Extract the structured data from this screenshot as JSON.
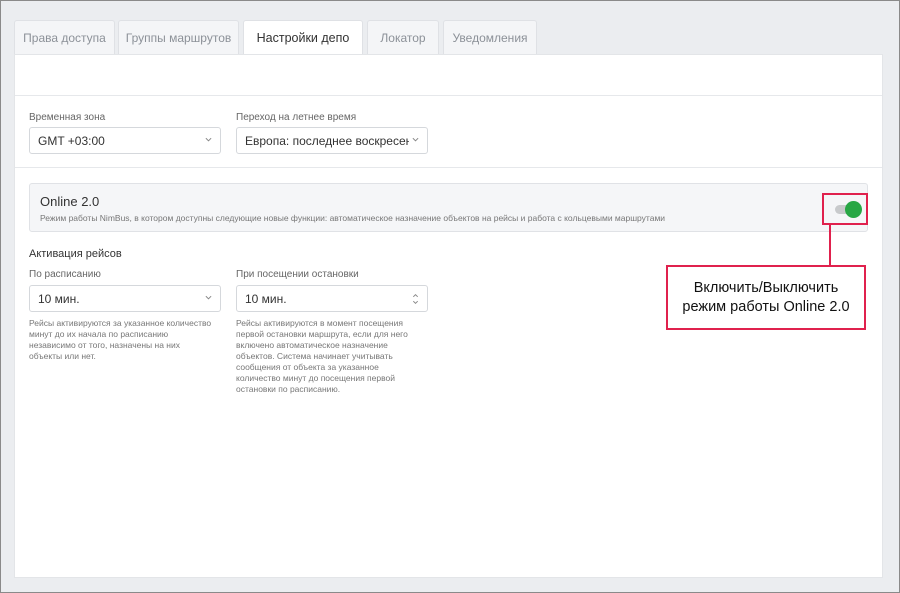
{
  "tabs": [
    {
      "label": "Права доступа",
      "active": false
    },
    {
      "label": "Группы маршрутов",
      "active": false
    },
    {
      "label": "Настройки депо",
      "active": true
    },
    {
      "label": "Локатор",
      "active": false
    },
    {
      "label": "Уведомления",
      "active": false
    }
  ],
  "timezone": {
    "label": "Временная зона",
    "value": "GMT +03:00"
  },
  "dst": {
    "label": "Переход на летнее время",
    "value": "Европа: последнее воскресенье..."
  },
  "online": {
    "title": "Online 2.0",
    "description": "Режим работы NimBus, в котором доступны следующие новые функции: автоматическое назначение объектов на рейсы и работа с кольцевыми маршрутами",
    "enabled": true
  },
  "activation": {
    "title": "Активация рейсов",
    "schedule": {
      "label": "По расписанию",
      "value": "10 мин.",
      "help": [
        "Рейсы активируются за указанное количество",
        "минут до их начала по расписанию",
        "независимо от того, назначены на них",
        "объекты или нет."
      ]
    },
    "stop_visit": {
      "label": "При посещении остановки",
      "value": "10 мин.",
      "help": [
        "Рейсы активируются в момент посещения",
        "первой остановки маршрута, если для него",
        "включено автоматическое назначение",
        "объектов. Система начинает учитывать",
        "сообщения от объекта за указанное",
        "количество минут до посещения первой",
        "остановки по расписанию."
      ]
    }
  },
  "callout": {
    "lines": [
      "Включить/Выключить",
      "режим работы Online 2.0"
    ]
  },
  "colors": {
    "accent_red": "#e0214d",
    "toggle_on": "#28a745"
  }
}
